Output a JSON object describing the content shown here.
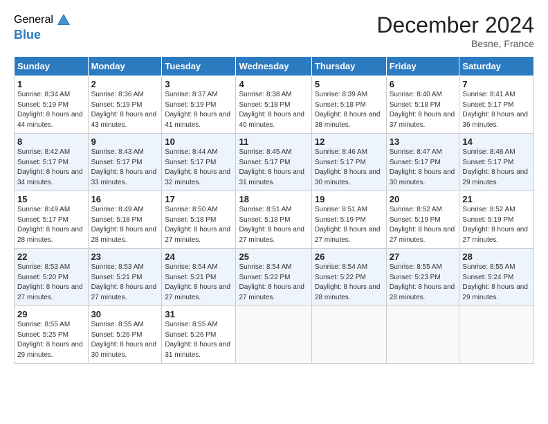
{
  "logo": {
    "general": "General",
    "blue": "Blue"
  },
  "title": "December 2024",
  "location": "Besne, France",
  "weekdays": [
    "Sunday",
    "Monday",
    "Tuesday",
    "Wednesday",
    "Thursday",
    "Friday",
    "Saturday"
  ],
  "weeks": [
    [
      {
        "day": "1",
        "sunrise": "Sunrise: 8:34 AM",
        "sunset": "Sunset: 5:19 PM",
        "daylight": "Daylight: 8 hours and 44 minutes."
      },
      {
        "day": "2",
        "sunrise": "Sunrise: 8:36 AM",
        "sunset": "Sunset: 5:19 PM",
        "daylight": "Daylight: 8 hours and 43 minutes."
      },
      {
        "day": "3",
        "sunrise": "Sunrise: 8:37 AM",
        "sunset": "Sunset: 5:19 PM",
        "daylight": "Daylight: 8 hours and 41 minutes."
      },
      {
        "day": "4",
        "sunrise": "Sunrise: 8:38 AM",
        "sunset": "Sunset: 5:18 PM",
        "daylight": "Daylight: 8 hours and 40 minutes."
      },
      {
        "day": "5",
        "sunrise": "Sunrise: 8:39 AM",
        "sunset": "Sunset: 5:18 PM",
        "daylight": "Daylight: 8 hours and 38 minutes."
      },
      {
        "day": "6",
        "sunrise": "Sunrise: 8:40 AM",
        "sunset": "Sunset: 5:18 PM",
        "daylight": "Daylight: 8 hours and 37 minutes."
      },
      {
        "day": "7",
        "sunrise": "Sunrise: 8:41 AM",
        "sunset": "Sunset: 5:17 PM",
        "daylight": "Daylight: 8 hours and 36 minutes."
      }
    ],
    [
      {
        "day": "8",
        "sunrise": "Sunrise: 8:42 AM",
        "sunset": "Sunset: 5:17 PM",
        "daylight": "Daylight: 8 hours and 34 minutes."
      },
      {
        "day": "9",
        "sunrise": "Sunrise: 8:43 AM",
        "sunset": "Sunset: 5:17 PM",
        "daylight": "Daylight: 8 hours and 33 minutes."
      },
      {
        "day": "10",
        "sunrise": "Sunrise: 8:44 AM",
        "sunset": "Sunset: 5:17 PM",
        "daylight": "Daylight: 8 hours and 32 minutes."
      },
      {
        "day": "11",
        "sunrise": "Sunrise: 8:45 AM",
        "sunset": "Sunset: 5:17 PM",
        "daylight": "Daylight: 8 hours and 31 minutes."
      },
      {
        "day": "12",
        "sunrise": "Sunrise: 8:46 AM",
        "sunset": "Sunset: 5:17 PM",
        "daylight": "Daylight: 8 hours and 30 minutes."
      },
      {
        "day": "13",
        "sunrise": "Sunrise: 8:47 AM",
        "sunset": "Sunset: 5:17 PM",
        "daylight": "Daylight: 8 hours and 30 minutes."
      },
      {
        "day": "14",
        "sunrise": "Sunrise: 8:48 AM",
        "sunset": "Sunset: 5:17 PM",
        "daylight": "Daylight: 8 hours and 29 minutes."
      }
    ],
    [
      {
        "day": "15",
        "sunrise": "Sunrise: 8:49 AM",
        "sunset": "Sunset: 5:17 PM",
        "daylight": "Daylight: 8 hours and 28 minutes."
      },
      {
        "day": "16",
        "sunrise": "Sunrise: 8:49 AM",
        "sunset": "Sunset: 5:18 PM",
        "daylight": "Daylight: 8 hours and 28 minutes."
      },
      {
        "day": "17",
        "sunrise": "Sunrise: 8:50 AM",
        "sunset": "Sunset: 5:18 PM",
        "daylight": "Daylight: 8 hours and 27 minutes."
      },
      {
        "day": "18",
        "sunrise": "Sunrise: 8:51 AM",
        "sunset": "Sunset: 5:18 PM",
        "daylight": "Daylight: 8 hours and 27 minutes."
      },
      {
        "day": "19",
        "sunrise": "Sunrise: 8:51 AM",
        "sunset": "Sunset: 5:19 PM",
        "daylight": "Daylight: 8 hours and 27 minutes."
      },
      {
        "day": "20",
        "sunrise": "Sunrise: 8:52 AM",
        "sunset": "Sunset: 5:19 PM",
        "daylight": "Daylight: 8 hours and 27 minutes."
      },
      {
        "day": "21",
        "sunrise": "Sunrise: 8:52 AM",
        "sunset": "Sunset: 5:19 PM",
        "daylight": "Daylight: 8 hours and 27 minutes."
      }
    ],
    [
      {
        "day": "22",
        "sunrise": "Sunrise: 8:53 AM",
        "sunset": "Sunset: 5:20 PM",
        "daylight": "Daylight: 8 hours and 27 minutes."
      },
      {
        "day": "23",
        "sunrise": "Sunrise: 8:53 AM",
        "sunset": "Sunset: 5:21 PM",
        "daylight": "Daylight: 8 hours and 27 minutes."
      },
      {
        "day": "24",
        "sunrise": "Sunrise: 8:54 AM",
        "sunset": "Sunset: 5:21 PM",
        "daylight": "Daylight: 8 hours and 27 minutes."
      },
      {
        "day": "25",
        "sunrise": "Sunrise: 8:54 AM",
        "sunset": "Sunset: 5:22 PM",
        "daylight": "Daylight: 8 hours and 27 minutes."
      },
      {
        "day": "26",
        "sunrise": "Sunrise: 8:54 AM",
        "sunset": "Sunset: 5:22 PM",
        "daylight": "Daylight: 8 hours and 28 minutes."
      },
      {
        "day": "27",
        "sunrise": "Sunrise: 8:55 AM",
        "sunset": "Sunset: 5:23 PM",
        "daylight": "Daylight: 8 hours and 28 minutes."
      },
      {
        "day": "28",
        "sunrise": "Sunrise: 8:55 AM",
        "sunset": "Sunset: 5:24 PM",
        "daylight": "Daylight: 8 hours and 29 minutes."
      }
    ],
    [
      {
        "day": "29",
        "sunrise": "Sunrise: 8:55 AM",
        "sunset": "Sunset: 5:25 PM",
        "daylight": "Daylight: 8 hours and 29 minutes."
      },
      {
        "day": "30",
        "sunrise": "Sunrise: 8:55 AM",
        "sunset": "Sunset: 5:26 PM",
        "daylight": "Daylight: 8 hours and 30 minutes."
      },
      {
        "day": "31",
        "sunrise": "Sunrise: 8:55 AM",
        "sunset": "Sunset: 5:26 PM",
        "daylight": "Daylight: 8 hours and 31 minutes."
      },
      null,
      null,
      null,
      null
    ]
  ]
}
